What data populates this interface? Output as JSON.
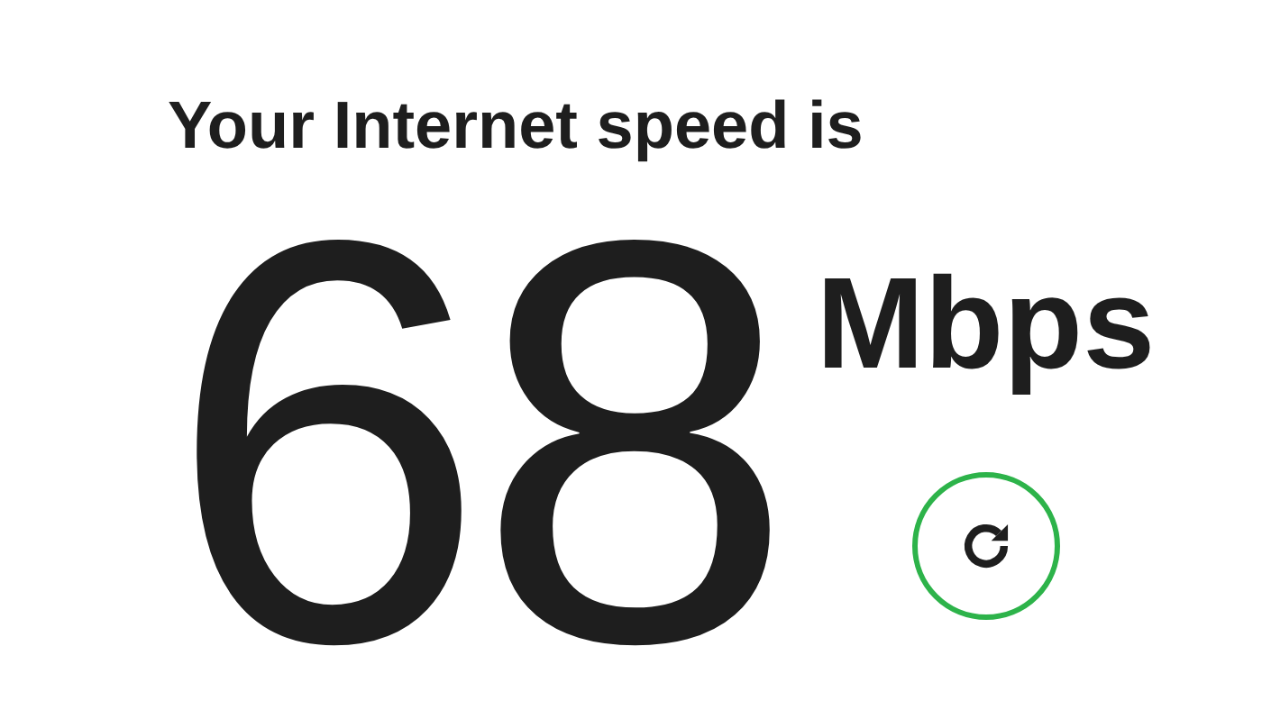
{
  "heading": "Your Internet speed is",
  "speed": {
    "value": "68",
    "unit": "Mbps"
  },
  "refresh_button": {
    "disabled": false
  }
}
